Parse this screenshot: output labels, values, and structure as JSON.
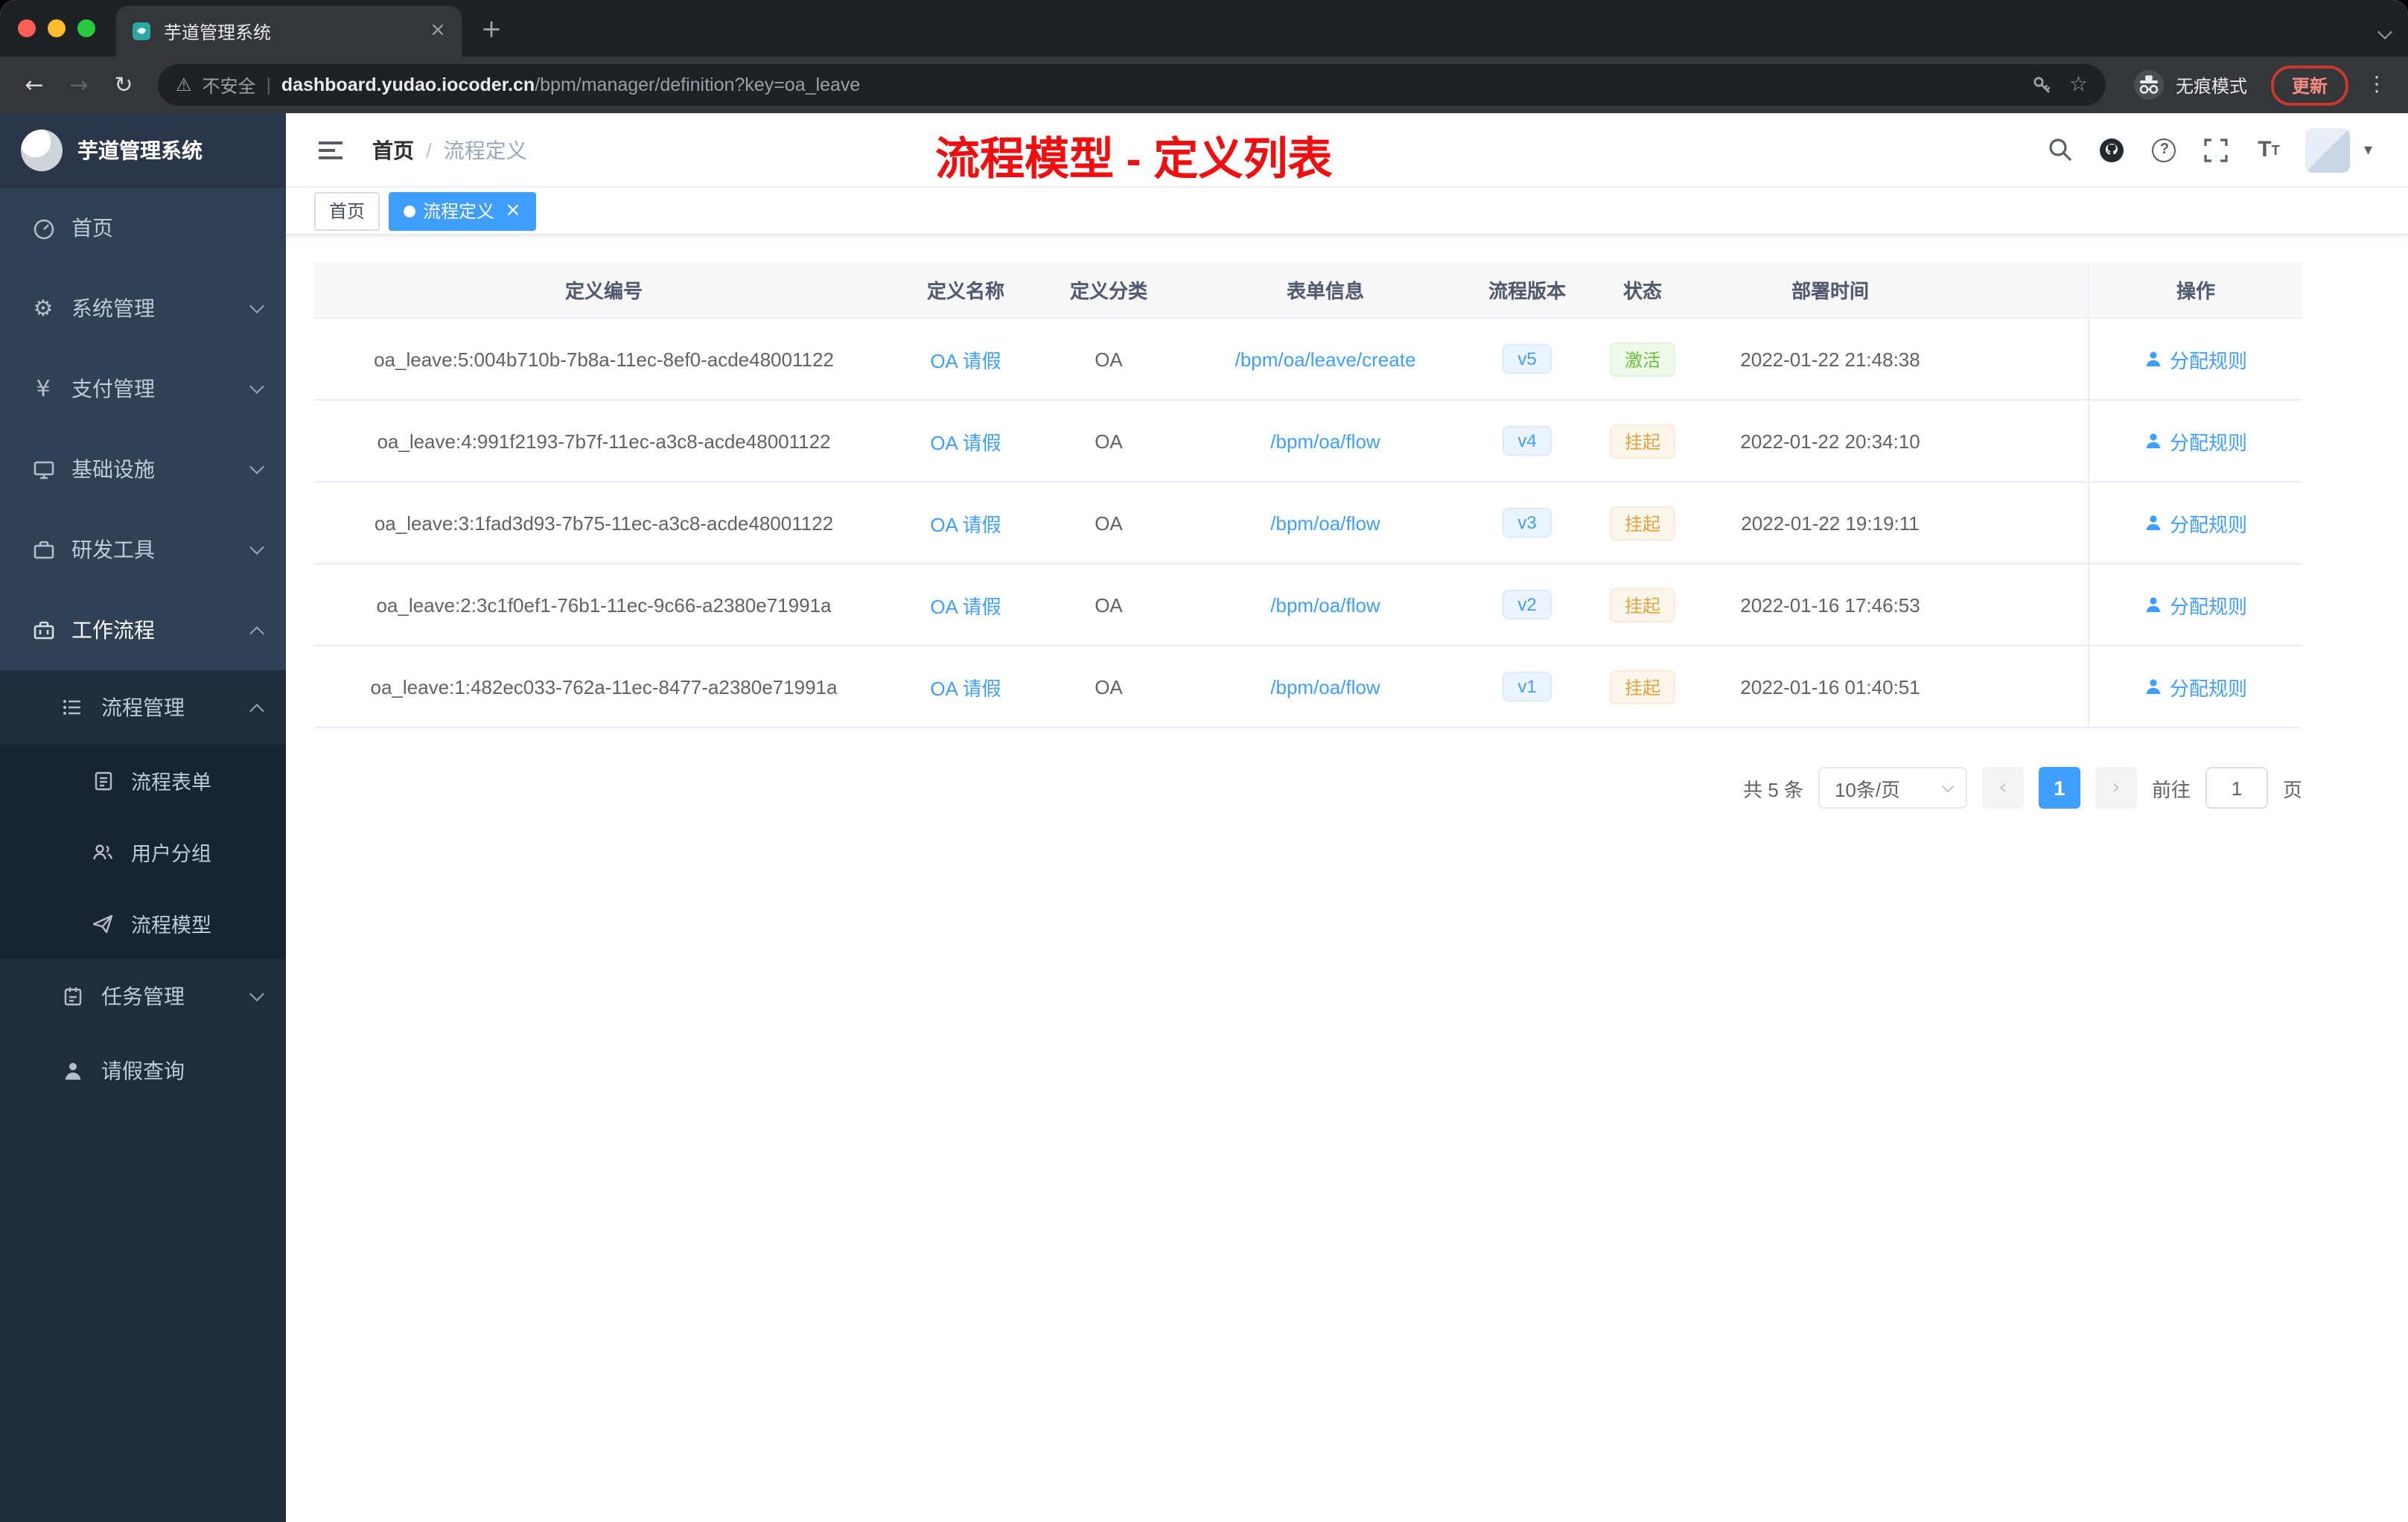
{
  "browser": {
    "tab_title": "芋道管理系统",
    "not_secure": "不安全",
    "url_domain": "dashboard.yudao.iocoder.cn",
    "url_path": "/bpm/manager/definition?key=oa_leave",
    "incognito_label": "无痕模式",
    "update_label": "更新"
  },
  "sidebar": {
    "app_title": "芋道管理系统",
    "items": [
      "首页",
      "系统管理",
      "支付管理",
      "基础设施",
      "研发工具",
      "工作流程"
    ],
    "process_mgmt": "流程管理",
    "process_children": [
      "流程表单",
      "用户分组",
      "流程模型"
    ],
    "task_mgmt": "任务管理",
    "leave_query": "请假查询"
  },
  "header": {
    "breadcrumb_home": "首页",
    "breadcrumb_sep": "/",
    "breadcrumb_current": "流程定义",
    "annotation": "流程模型 - 定义列表"
  },
  "tags": {
    "home": "首页",
    "active": "流程定义"
  },
  "table": {
    "columns": [
      "定义编号",
      "定义名称",
      "定义分类",
      "表单信息",
      "流程版本",
      "状态",
      "部署时间",
      "操作"
    ],
    "rows": [
      {
        "id": "oa_leave:5:004b710b-7b8a-11ec-8ef0-acde48001122",
        "name": "OA 请假",
        "category": "OA",
        "form": "/bpm/oa/leave/create",
        "version": "v5",
        "status": "激活",
        "status_type": "success",
        "time": "2022-01-22 21:48:38",
        "action": "分配规则"
      },
      {
        "id": "oa_leave:4:991f2193-7b7f-11ec-a3c8-acde48001122",
        "name": "OA 请假",
        "category": "OA",
        "form": "/bpm/oa/flow",
        "version": "v4",
        "status": "挂起",
        "status_type": "warning",
        "time": "2022-01-22 20:34:10",
        "action": "分配规则"
      },
      {
        "id": "oa_leave:3:1fad3d93-7b75-11ec-a3c8-acde48001122",
        "name": "OA 请假",
        "category": "OA",
        "form": "/bpm/oa/flow",
        "version": "v3",
        "status": "挂起",
        "status_type": "warning",
        "time": "2022-01-22 19:19:11",
        "action": "分配规则"
      },
      {
        "id": "oa_leave:2:3c1f0ef1-76b1-11ec-9c66-a2380e71991a",
        "name": "OA 请假",
        "category": "OA",
        "form": "/bpm/oa/flow",
        "version": "v2",
        "status": "挂起",
        "status_type": "warning",
        "time": "2022-01-16 17:46:53",
        "action": "分配规则"
      },
      {
        "id": "oa_leave:1:482ec033-762a-11ec-8477-a2380e71991a",
        "name": "OA 请假",
        "category": "OA",
        "form": "/bpm/oa/flow",
        "version": "v1",
        "status": "挂起",
        "status_type": "warning",
        "time": "2022-01-16 01:40:51",
        "action": "分配规则"
      }
    ]
  },
  "pagination": {
    "total": "共 5 条",
    "page_size": "10条/页",
    "prev": "‹",
    "page": "1",
    "next": "›",
    "goto_label": "前往",
    "goto_value": "1",
    "goto_unit": "页"
  },
  "icons": [
    "favicon",
    "close-icon",
    "new-tab-icon",
    "tab-search-icon",
    "back-icon",
    "forward-icon",
    "reload-icon",
    "warning-icon",
    "key-icon",
    "star-icon",
    "incognito-icon",
    "menu-dots-icon",
    "dashboard-icon",
    "gear-icon",
    "yen-icon",
    "infrastructure-icon",
    "tools-icon",
    "workflow-icon",
    "list-icon",
    "form-icon",
    "user-group-icon",
    "paper-plane-icon",
    "task-icon",
    "person-icon",
    "hamburger-icon",
    "search-icon",
    "github-icon",
    "question-icon",
    "fullscreen-icon",
    "font-size-icon",
    "chevron-down-icon",
    "chevron-up-icon"
  ],
  "colors": {
    "accent": "#409eff",
    "success": "#67c23a",
    "warning": "#e6a23c",
    "annotation_red": "#ee1010",
    "sidebar_bg": "#304156",
    "submenu_bg": "#1f2d3d",
    "active_tag_bg": "#409eff"
  }
}
